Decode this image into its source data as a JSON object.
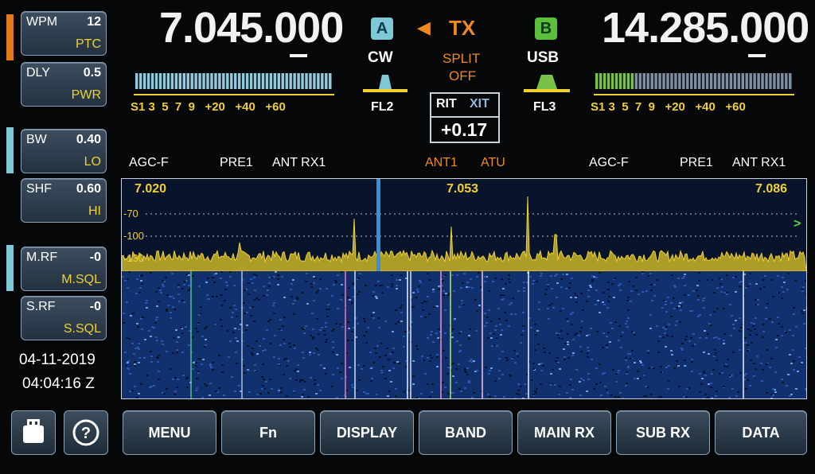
{
  "side_keys": [
    {
      "name": "wpm",
      "label": "WPM",
      "value": "12",
      "sub": "PTC"
    },
    {
      "name": "dly",
      "label": "DLY",
      "value": "0.5",
      "sub": "PWR"
    },
    {
      "name": "bw",
      "label": "BW",
      "value": "0.40",
      "sub": "LO"
    },
    {
      "name": "shf",
      "label": "SHF",
      "value": "0.60",
      "sub": "HI"
    },
    {
      "name": "mrf",
      "label": "M.RF",
      "value": "-0",
      "sub": "M.SQL"
    },
    {
      "name": "srf",
      "label": "S.RF",
      "value": "-0",
      "sub": "S.SQL"
    }
  ],
  "indicator_colors": {
    "wpm": "#e07a1a",
    "bw": "#7fc8d8",
    "mrf": "#7fc8d8"
  },
  "date": "04-11-2019",
  "time": "04:04:16 Z",
  "vfo_a": {
    "badge": "A",
    "frequency_main": "7.045.0",
    "frequency_tail": "00",
    "mode": "CW",
    "filter": "FL2",
    "badge_color": "#7fc8d8"
  },
  "vfo_b": {
    "badge": "B",
    "frequency_main": "14.285.0",
    "frequency_tail": "00",
    "mode": "USB",
    "filter": "FL3",
    "badge_color": "#5cbf3c"
  },
  "tx": {
    "arrow": "◀",
    "label": "TX",
    "split_line1": "SPLIT",
    "split_line2": "OFF"
  },
  "rit_xit": {
    "rit": "RIT",
    "xit": "XIT",
    "value": "+0.17"
  },
  "smeter_scale": [
    "S1",
    "3",
    "5",
    "7",
    "9",
    "+20",
    "+40",
    "+60"
  ],
  "smeter": {
    "main_level": 1.0,
    "sub_level": 0.2,
    "main_color": "#8fcbe0",
    "sub_color": "#79c24a"
  },
  "status_left": {
    "agc": "AGC-F",
    "pre": "PRE1",
    "ant": "ANT RX1"
  },
  "status_center": {
    "ant": "ANT1",
    "atu": "ATU"
  },
  "status_right": {
    "agc": "AGC-F",
    "pre": "PRE1",
    "ant": "ANT RX1"
  },
  "panadapter": {
    "freq_left": "7.020",
    "freq_center": "7.053",
    "freq_right": "7.086",
    "db_labels": [
      "-70",
      "-100",
      "-130"
    ],
    "ref_marker": ">"
  },
  "soft_buttons": [
    "MENU",
    "Fn",
    "DISPLAY",
    "BAND",
    "MAIN RX",
    "SUB RX",
    "DATA"
  ],
  "icons": {
    "usb": "usb-drive-icon",
    "help": "help-icon"
  }
}
